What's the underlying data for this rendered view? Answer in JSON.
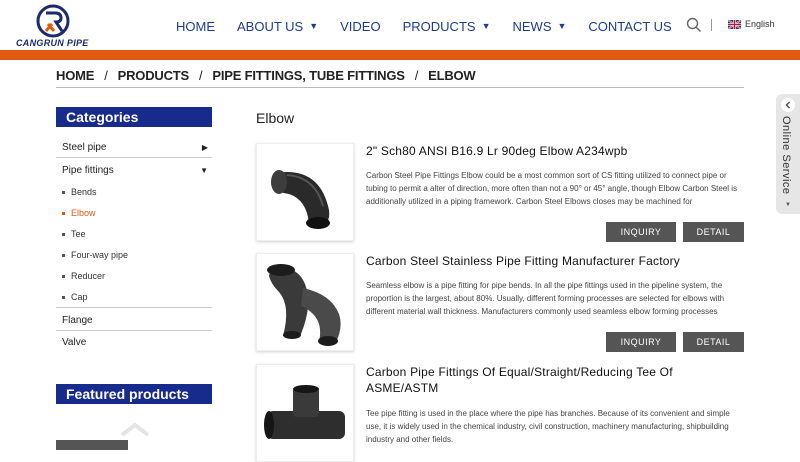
{
  "brand": {
    "logo_text": "CANGRUN PIPE"
  },
  "nav": {
    "items": [
      {
        "label": "HOME",
        "has_dropdown": false
      },
      {
        "label": "ABOUT US",
        "has_dropdown": true
      },
      {
        "label": "VIDEO",
        "has_dropdown": false
      },
      {
        "label": "PRODUCTS",
        "has_dropdown": true
      },
      {
        "label": "NEWS",
        "has_dropdown": true
      },
      {
        "label": "CONTACT US",
        "has_dropdown": false
      }
    ],
    "language": "English"
  },
  "breadcrumb": [
    "HOME",
    "PRODUCTS",
    "PIPE FITTINGS, TUBE FITTINGS",
    "ELBOW"
  ],
  "sidebar": {
    "categories_title": "Categories",
    "categories": [
      {
        "label": "Steel pipe",
        "arrow": "▶"
      },
      {
        "label": "Pipe fittings",
        "arrow": "▼"
      },
      {
        "label": "Flange"
      },
      {
        "label": "Valve"
      }
    ],
    "sub_items": [
      "Bends",
      "Elbow",
      "Tee",
      "Four-way pipe",
      "Reducer",
      "Cap"
    ],
    "active_sub": "Elbow",
    "featured_title": "Featured products"
  },
  "main": {
    "section_title": "Elbow",
    "inquiry_label": "INQUIRY",
    "detail_label": "DETAIL",
    "products": [
      {
        "title": "2\" Sch80 ANSI B16.9 Lr 90deg Elbow A234wpb",
        "description": "Carbon Steel Pipe Fittings Elbow could be a most common sort of CS fitting utilized to connect pipe or tubing to permit a alter of direction, more often than not a 90° or 45° angle, though Elbow Carbon Steel is additionally utilized in a piping framework. Carbon Steel Elbows closes may be machined for"
      },
      {
        "title": "Carbon Steel Stainless Pipe Fitting Manufacturer Factory",
        "description": "Seamless elbow is a pipe fitting for pipe bends. In all the pipe fittings used in the pipeline system, the proportion is the largest, about 80%. Usually, different forming processes are selected for elbows with different material wall thickness. Manufacturers commonly used seamless elbow forming processes"
      },
      {
        "title": "Carbon Pipe Fittings Of Equal/Straight/Reducing Tee Of ASME/ASTM",
        "description": "Tee pipe fitting is used in the place where the pipe has branches. Because of its convenient and simple use, it is widely used in the chemical industry, civil construction, machinery manufacturing, shipbuilding industry and other fields."
      }
    ]
  },
  "online_service": {
    "label": "Online Service"
  },
  "colors": {
    "nav_blue": "#1d3c8c",
    "accent_orange": "#e05a12",
    "sidebar_blue": "#172b8c",
    "button_gray": "#555555"
  }
}
